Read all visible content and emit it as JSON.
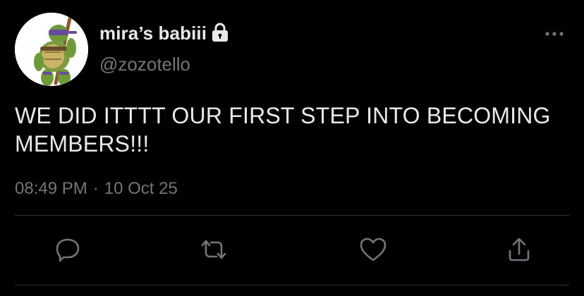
{
  "user": {
    "display_name": "mira’s babiii",
    "handle": "@zozotello",
    "avatar_icon": "ninja-turtle-avatar-icon",
    "protected_icon": "lock-icon"
  },
  "tweet": {
    "text": "WE DID ITTTT OUR FIRST STEP INTO BECOMING MEMBERS!!!",
    "time": "08:49 PM",
    "separator": "·",
    "date": "10 Oct 25"
  },
  "actions": [
    {
      "name": "reply",
      "icon": "reply-icon"
    },
    {
      "name": "retweet",
      "icon": "retweet-icon"
    },
    {
      "name": "like",
      "icon": "heart-icon"
    },
    {
      "name": "share",
      "icon": "share-icon"
    }
  ],
  "colors": {
    "background": "#000000",
    "primary_text": "#e7e9ea",
    "secondary_text": "#71767b",
    "divider": "#2f3336"
  }
}
